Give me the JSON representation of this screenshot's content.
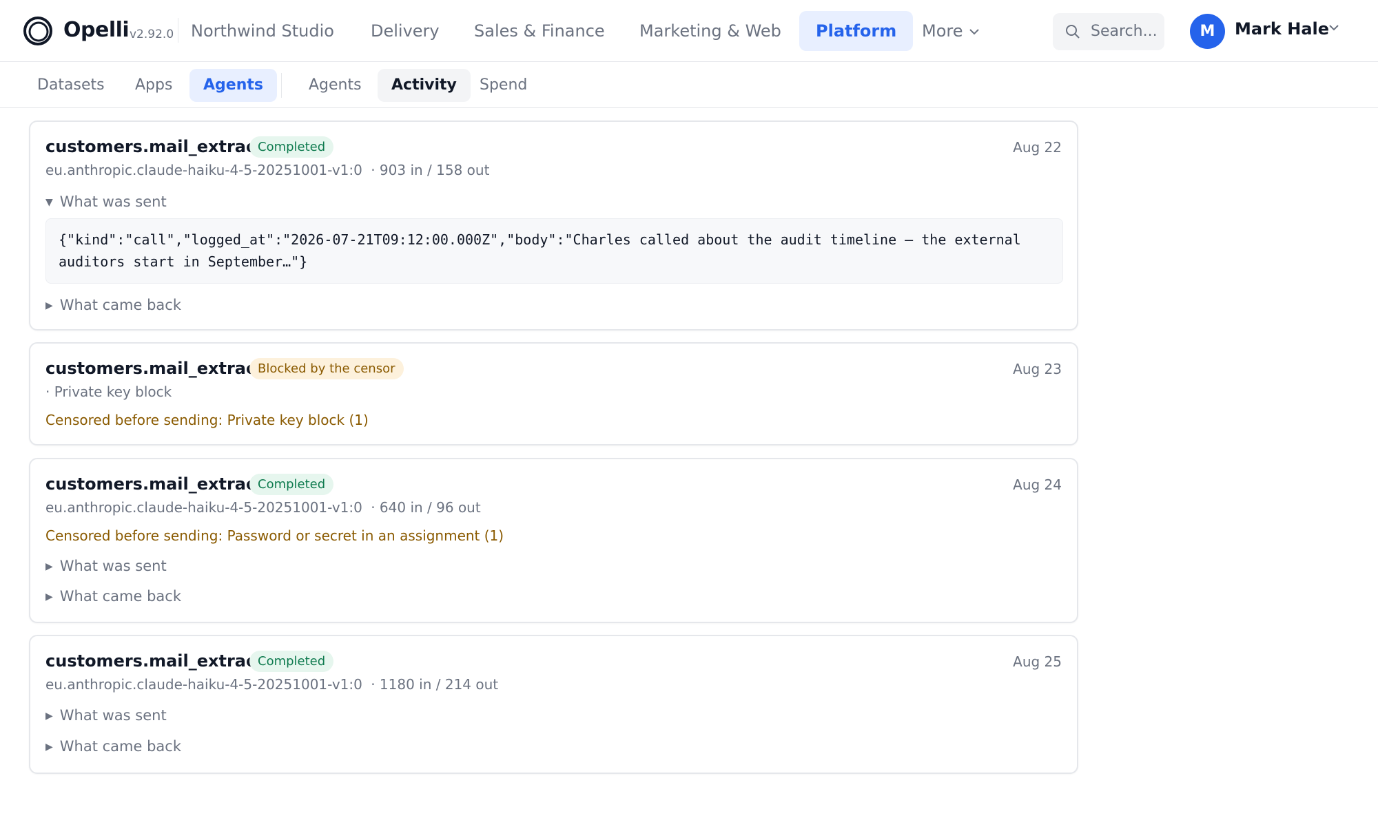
{
  "brand": {
    "name": "Opelli",
    "version": "v2.92.0"
  },
  "nav": {
    "items": [
      {
        "label": "Northwind Studio"
      },
      {
        "label": "Delivery"
      },
      {
        "label": "Sales & Finance"
      },
      {
        "label": "Marketing & Web"
      },
      {
        "label": "Platform",
        "active": true
      },
      {
        "label": "More"
      }
    ]
  },
  "search": {
    "placeholder": "Search..."
  },
  "user": {
    "initial": "M",
    "name": "Mark Hale"
  },
  "subnav": {
    "primary": [
      {
        "label": "Datasets"
      },
      {
        "label": "Apps"
      },
      {
        "label": "Agents",
        "active": true
      }
    ],
    "secondary": [
      {
        "label": "Agents"
      },
      {
        "label": "Activity",
        "active": true
      },
      {
        "label": "Spend"
      }
    ]
  },
  "colors": {
    "accent": "#2563eb",
    "success": "#0f7b4f",
    "warning": "#8a5a00"
  },
  "icons": {
    "logo": "ring-logo-icon",
    "search": "search-icon",
    "chevron": "chevron-down-icon"
  },
  "activity": [
    {
      "title": "customers.mail_extract",
      "status": "Completed",
      "date": "Aug 22",
      "model": "eu.anthropic.claude-haiku-4-5-20251001-v1:0",
      "tokens": "· 903 in / 158 out",
      "sent_label": "What was sent",
      "sent_body": "{\"kind\":\"call\",\"logged_at\":\"2026-07-21T09:12:00.000Z\",\"body\":\"Charles called about the audit timeline — the external auditors start in September…\"}",
      "back_label": "What came back"
    },
    {
      "title": "customers.mail_extract",
      "status": "Blocked by the censor",
      "date": "Aug 23",
      "meta": "· Private key block",
      "censor": "Censored before sending: Private key block (1)"
    },
    {
      "title": "customers.mail_extract",
      "status": "Completed",
      "date": "Aug 24",
      "model": "eu.anthropic.claude-haiku-4-5-20251001-v1:0",
      "tokens": "· 640 in / 96 out",
      "censor": "Censored before sending: Password or secret in an assignment (1)",
      "sent_label": "What was sent",
      "back_label": "What came back"
    },
    {
      "title": "customers.mail_extract",
      "status": "Completed",
      "date": "Aug 25",
      "model": "eu.anthropic.claude-haiku-4-5-20251001-v1:0",
      "tokens": "· 1180 in / 214 out",
      "sent_label": "What was sent",
      "back_label": "What came back"
    }
  ]
}
